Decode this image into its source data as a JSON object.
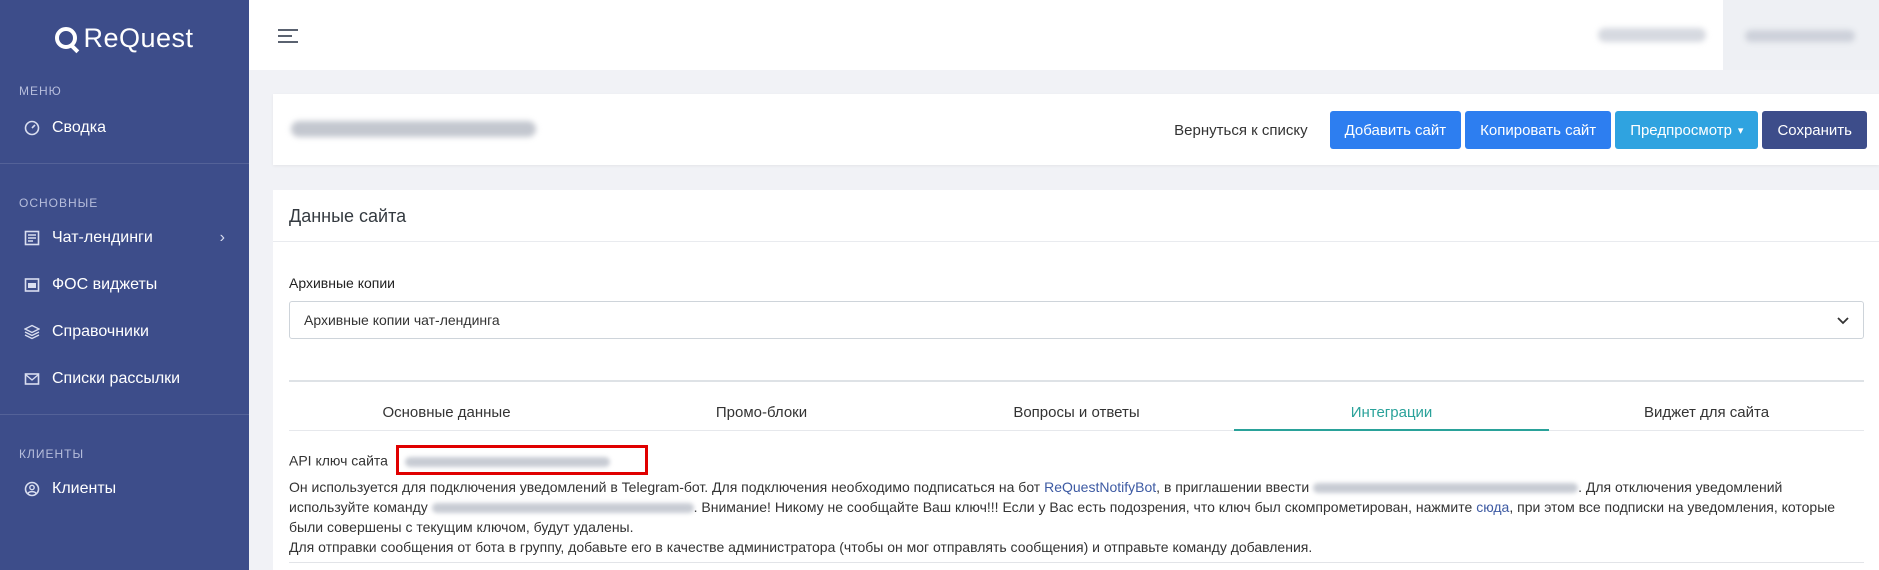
{
  "brand": {
    "name": "ReQuest"
  },
  "sidebar": {
    "sections": {
      "menu": "МЕНЮ",
      "main": "ОСНОВНЫЕ",
      "clients": "КЛИЕНТЫ"
    },
    "items": [
      {
        "label": "Сводка",
        "icon": "dashboard-icon"
      },
      {
        "label": "Чат-лендинги",
        "icon": "list-icon"
      },
      {
        "label": "ФОС виджеты",
        "icon": "widget-icon"
      },
      {
        "label": "Справочники",
        "icon": "layers-icon"
      },
      {
        "label": "Списки рассылки",
        "icon": "mail-icon"
      },
      {
        "label": "Клиенты",
        "icon": "user-icon"
      }
    ]
  },
  "header": {
    "back_label": "Вернуться к списку",
    "add_label": "Добавить сайт",
    "copy_label": "Копировать сайт",
    "preview_label": "Предпросмотр",
    "save_label": "Сохранить"
  },
  "main": {
    "title": "Данные сайта",
    "archive_label": "Архивные копии",
    "archive_value": "Архивные копии чат-лендинга",
    "tabs": [
      {
        "label": "Основные данные"
      },
      {
        "label": "Промо-блоки"
      },
      {
        "label": "Вопросы и ответы"
      },
      {
        "label": "Интеграции"
      },
      {
        "label": "Виджет для сайта"
      }
    ],
    "info": {
      "api_key_label": "API ключ сайта",
      "p1_a": "Он используется для подключения уведомлений в Telegram-бот. Для подключения необходимо подписаться на бот ",
      "bot_link": "ReQuestNotifyBot",
      "p1_b": ", в приглашении ввести ",
      "p1_c": ". Для отключения уведомлений используйте команду ",
      "p1_d": ". Внимание! Никому не сообщайте Ваш ключ!!! Если у Вас есть подозрения, что ключ был скомпрометирован, нажмите ",
      "here_link": "сюда",
      "p1_e": ", при этом все подписки на уведомления, которые были совершены с текущим ключом, будут удалены.",
      "p2": "Для отправки сообщения от бота в группу, добавьте его в качестве администратора (чтобы он мог отправлять сообщения) и отправьте команду добавления."
    }
  },
  "colors": {
    "sidebar": "#3d4d8a",
    "primary": "#2d7ef0",
    "preview": "#2fa3e0",
    "save": "#3d4d8a",
    "active_tab": "#2aa29a",
    "highlight": "#e00000"
  }
}
